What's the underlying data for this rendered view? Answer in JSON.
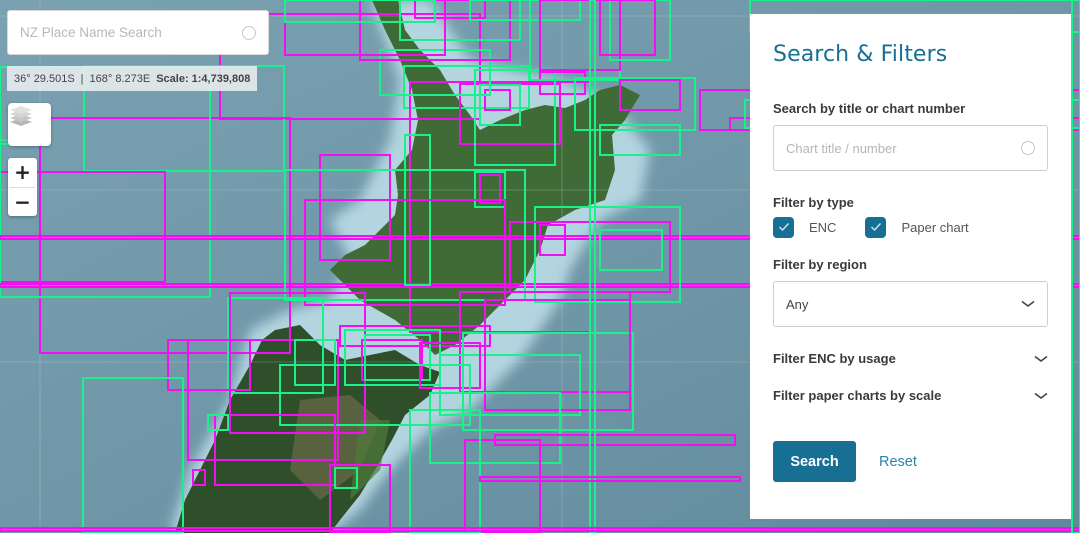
{
  "map": {
    "place_search": {
      "placeholder": "NZ Place Name Search",
      "value": ""
    },
    "coordinates": {
      "latitude": "36° 29.501S",
      "separator": "|",
      "longitude": "168° 8.273E"
    },
    "scale": {
      "label": "Scale:",
      "value": "1:4,739,808"
    },
    "controls": {
      "layers_icon": "layers-icon",
      "zoom_in": "+",
      "zoom_out": "−"
    },
    "legend_colors": {
      "enc": "#19f28a",
      "paper_chart": "#f20ff0"
    }
  },
  "panel": {
    "title": "Search & Filters",
    "search": {
      "label": "Search by title or chart number",
      "placeholder": "Chart title / number",
      "value": ""
    },
    "type_filter": {
      "label": "Filter by type",
      "options": [
        {
          "label": "ENC",
          "checked": true
        },
        {
          "label": "Paper chart",
          "checked": true
        }
      ]
    },
    "region_filter": {
      "label": "Filter by region",
      "selected": "Any"
    },
    "accordions": [
      {
        "label": "Filter ENC by usage",
        "expanded": false
      },
      {
        "label": "Filter paper charts by scale",
        "expanded": false
      }
    ],
    "actions": {
      "search": "Search",
      "reset": "Reset"
    },
    "accent_color": "#176f93"
  }
}
